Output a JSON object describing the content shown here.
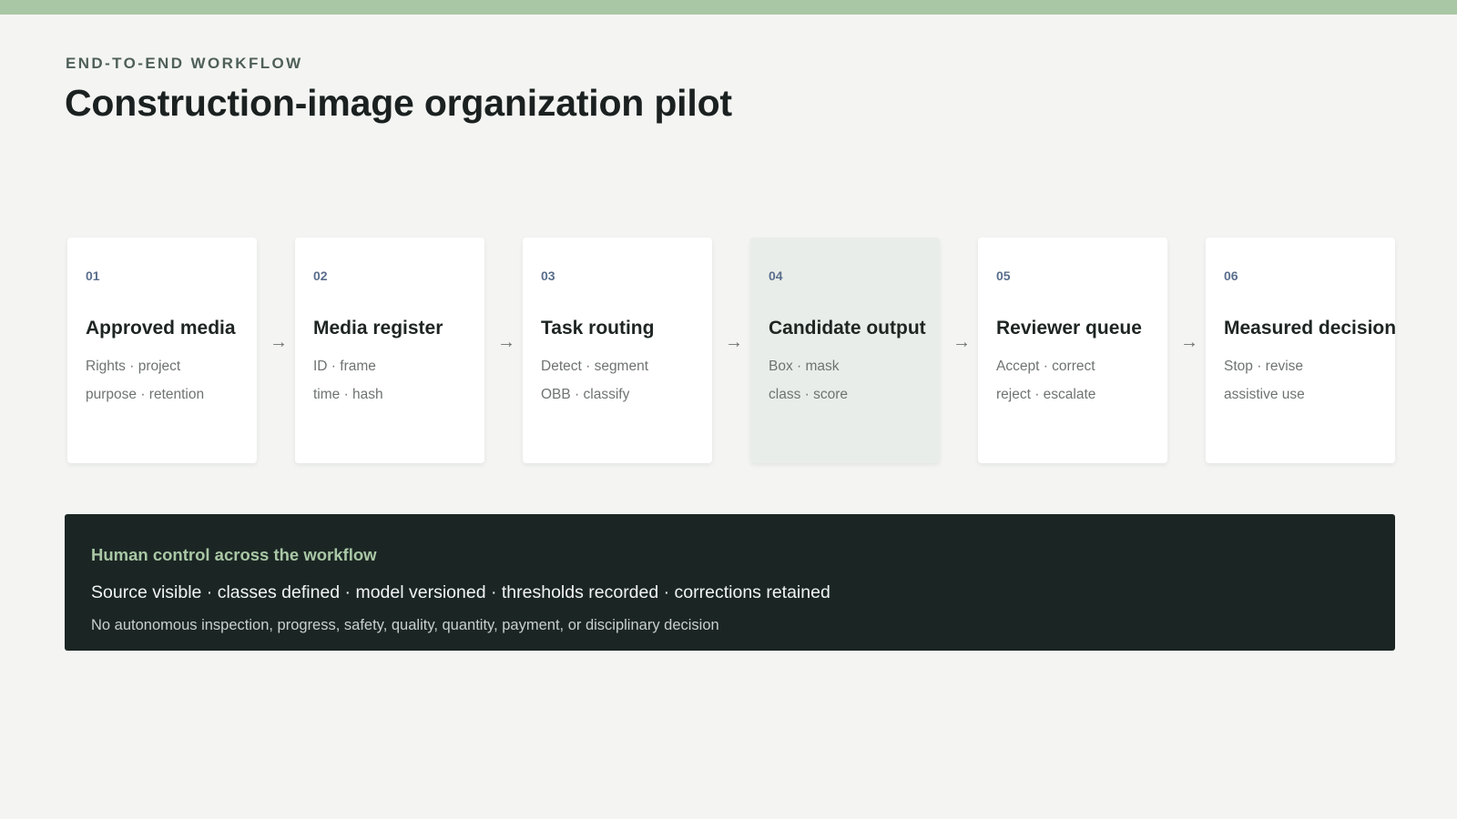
{
  "slide": {
    "eyebrow": "END-TO-END WORKFLOW",
    "title": "Construction-image organization pilot"
  },
  "steps": [
    {
      "number": "01",
      "title": "Approved media",
      "line1": "Rights · project",
      "line2": "purpose · retention",
      "highlighted": false
    },
    {
      "number": "02",
      "title": "Media register",
      "line1": "ID · frame",
      "line2": "time · hash",
      "highlighted": false
    },
    {
      "number": "03",
      "title": "Task routing",
      "line1": "Detect · segment",
      "line2": "OBB · classify",
      "highlighted": false
    },
    {
      "number": "04",
      "title": "Candidate output",
      "line1": "Box · mask",
      "line2": "class · score",
      "highlighted": true
    },
    {
      "number": "05",
      "title": "Reviewer queue",
      "line1": "Accept · correct",
      "line2": "reject · escalate",
      "highlighted": false
    },
    {
      "number": "06",
      "title": "Measured decision",
      "line1": "Stop · revise",
      "line2": "assistive use",
      "highlighted": false
    }
  ],
  "arrow_glyph": "→",
  "control_band": {
    "heading": "Human control across the workflow",
    "controls": "Source visible · classes defined · model versioned · thresholds recorded · corrections retained",
    "note": "No autonomous inspection, progress, safety, quality, quantity, payment, or disciplinary decision"
  },
  "colors": {
    "accent_bar": "#a9c7a5",
    "step_number": "#5a6e8c",
    "band_background": "#1b2624",
    "band_heading": "#a9c7a5",
    "highlight_card": "#e9ede9"
  }
}
